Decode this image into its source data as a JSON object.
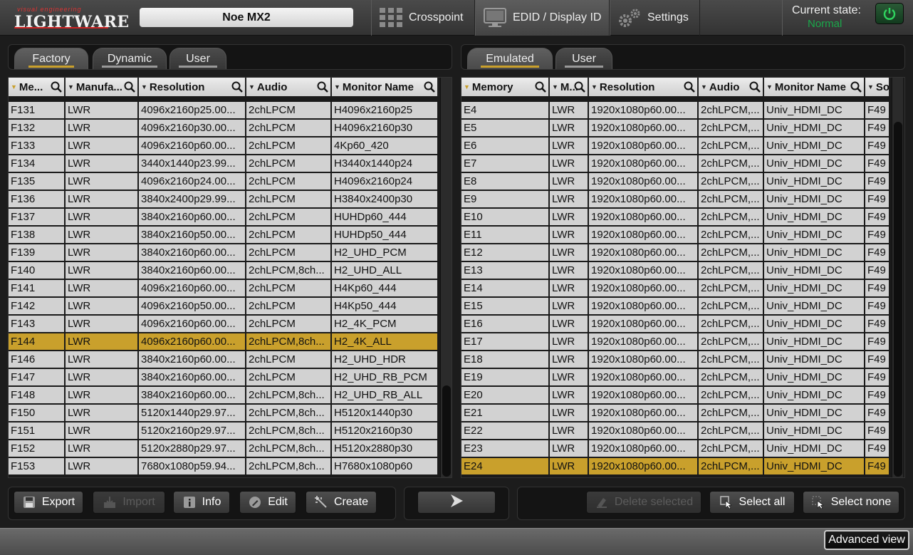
{
  "header": {
    "logo_tag": "visual engineering",
    "logo_brand": "LIGHTWARE",
    "device_name": "Noe MX2",
    "nav": [
      {
        "label": "Crosspoint",
        "icon": "crosspoint-grid-icon"
      },
      {
        "label": "EDID / Display ID",
        "icon": "monitor-icon"
      },
      {
        "label": "Settings",
        "icon": "gears-icon"
      }
    ],
    "active_nav": "EDID / Display ID",
    "state_label": "Current state:",
    "state_value": "Normal",
    "state_color": "#1aa84a"
  },
  "left_panel": {
    "tabs": [
      {
        "label": "Factory"
      },
      {
        "label": "Dynamic"
      },
      {
        "label": "User"
      }
    ],
    "active_tab": "Factory",
    "columns": [
      "Me...",
      "Manufa...",
      "Resolution",
      "Audio",
      "Monitor Name"
    ],
    "rows": [
      [
        "F131",
        "LWR",
        "4096x2160p25.00...",
        "2chLPCM",
        "H4096x2160p25"
      ],
      [
        "F132",
        "LWR",
        "4096x2160p30.00...",
        "2chLPCM",
        "H4096x2160p30"
      ],
      [
        "F133",
        "LWR",
        "4096x2160p60.00...",
        "2chLPCM",
        "4Kp60_420"
      ],
      [
        "F134",
        "LWR",
        "3440x1440p23.99...",
        "2chLPCM",
        "H3440x1440p24"
      ],
      [
        "F135",
        "LWR",
        "4096x2160p24.00...",
        "2chLPCM",
        "H4096x2160p24"
      ],
      [
        "F136",
        "LWR",
        "3840x2400p29.99...",
        "2chLPCM",
        "H3840x2400p30"
      ],
      [
        "F137",
        "LWR",
        "3840x2160p60.00...",
        "2chLPCM",
        "HUHDp60_444"
      ],
      [
        "F138",
        "LWR",
        "3840x2160p50.00...",
        "2chLPCM",
        "HUHDp50_444"
      ],
      [
        "F139",
        "LWR",
        "3840x2160p60.00...",
        "2chLPCM",
        "H2_UHD_PCM"
      ],
      [
        "F140",
        "LWR",
        "3840x2160p60.00...",
        "2chLPCM,8ch...",
        "H2_UHD_ALL"
      ],
      [
        "F141",
        "LWR",
        "4096x2160p60.00...",
        "2chLPCM",
        "H4Kp60_444"
      ],
      [
        "F142",
        "LWR",
        "4096x2160p50.00...",
        "2chLPCM",
        "H4Kp50_444"
      ],
      [
        "F143",
        "LWR",
        "4096x2160p60.00...",
        "2chLPCM",
        "H2_4K_PCM"
      ],
      [
        "F144",
        "LWR",
        "4096x2160p60.00...",
        "2chLPCM,8ch...",
        "H2_4K_ALL"
      ],
      [
        "F146",
        "LWR",
        "3840x2160p60.00...",
        "2chLPCM",
        "H2_UHD_HDR"
      ],
      [
        "F147",
        "LWR",
        "3840x2160p60.00...",
        "2chLPCM",
        "H2_UHD_RB_PCM"
      ],
      [
        "F148",
        "LWR",
        "3840x2160p60.00...",
        "2chLPCM,8ch...",
        "H2_UHD_RB_ALL"
      ],
      [
        "F150",
        "LWR",
        "5120x1440p29.97...",
        "2chLPCM,8ch...",
        "H5120x1440p30"
      ],
      [
        "F151",
        "LWR",
        "5120x2160p29.97...",
        "2chLPCM,8ch...",
        "H5120x2160p30"
      ],
      [
        "F152",
        "LWR",
        "5120x2880p29.97...",
        "2chLPCM,8ch...",
        "H5120x2880p30"
      ],
      [
        "F153",
        "LWR",
        "7680x1080p59.94...",
        "2chLPCM,8ch...",
        "H7680x1080p60"
      ]
    ],
    "selected_row": "F144"
  },
  "right_panel": {
    "tabs": [
      {
        "label": "Emulated"
      },
      {
        "label": "User"
      }
    ],
    "active_tab": "Emulated",
    "columns": [
      "Memory",
      "M...",
      "Resolution",
      "Audio",
      "Monitor Name",
      "So..."
    ],
    "rows": [
      [
        "E4",
        "LWR",
        "1920x1080p60.00...",
        "2chLPCM,...",
        "Univ_HDMI_DC",
        "F49"
      ],
      [
        "E5",
        "LWR",
        "1920x1080p60.00...",
        "2chLPCM,...",
        "Univ_HDMI_DC",
        "F49"
      ],
      [
        "E6",
        "LWR",
        "1920x1080p60.00...",
        "2chLPCM,...",
        "Univ_HDMI_DC",
        "F49"
      ],
      [
        "E7",
        "LWR",
        "1920x1080p60.00...",
        "2chLPCM,...",
        "Univ_HDMI_DC",
        "F49"
      ],
      [
        "E8",
        "LWR",
        "1920x1080p60.00...",
        "2chLPCM,...",
        "Univ_HDMI_DC",
        "F49"
      ],
      [
        "E9",
        "LWR",
        "1920x1080p60.00...",
        "2chLPCM,...",
        "Univ_HDMI_DC",
        "F49"
      ],
      [
        "E10",
        "LWR",
        "1920x1080p60.00...",
        "2chLPCM,...",
        "Univ_HDMI_DC",
        "F49"
      ],
      [
        "E11",
        "LWR",
        "1920x1080p60.00...",
        "2chLPCM,...",
        "Univ_HDMI_DC",
        "F49"
      ],
      [
        "E12",
        "LWR",
        "1920x1080p60.00...",
        "2chLPCM,...",
        "Univ_HDMI_DC",
        "F49"
      ],
      [
        "E13",
        "LWR",
        "1920x1080p60.00...",
        "2chLPCM,...",
        "Univ_HDMI_DC",
        "F49"
      ],
      [
        "E14",
        "LWR",
        "1920x1080p60.00...",
        "2chLPCM,...",
        "Univ_HDMI_DC",
        "F49"
      ],
      [
        "E15",
        "LWR",
        "1920x1080p60.00...",
        "2chLPCM,...",
        "Univ_HDMI_DC",
        "F49"
      ],
      [
        "E16",
        "LWR",
        "1920x1080p60.00...",
        "2chLPCM,...",
        "Univ_HDMI_DC",
        "F49"
      ],
      [
        "E17",
        "LWR",
        "1920x1080p60.00...",
        "2chLPCM,...",
        "Univ_HDMI_DC",
        "F49"
      ],
      [
        "E18",
        "LWR",
        "1920x1080p60.00...",
        "2chLPCM,...",
        "Univ_HDMI_DC",
        "F49"
      ],
      [
        "E19",
        "LWR",
        "1920x1080p60.00...",
        "2chLPCM,...",
        "Univ_HDMI_DC",
        "F49"
      ],
      [
        "E20",
        "LWR",
        "1920x1080p60.00...",
        "2chLPCM,...",
        "Univ_HDMI_DC",
        "F49"
      ],
      [
        "E21",
        "LWR",
        "1920x1080p60.00...",
        "2chLPCM,...",
        "Univ_HDMI_DC",
        "F49"
      ],
      [
        "E22",
        "LWR",
        "1920x1080p60.00...",
        "2chLPCM,...",
        "Univ_HDMI_DC",
        "F49"
      ],
      [
        "E23",
        "LWR",
        "1920x1080p60.00...",
        "2chLPCM,...",
        "Univ_HDMI_DC",
        "F49"
      ],
      [
        "E24",
        "LWR",
        "1920x1080p60.00...",
        "2chLPCM,...",
        "Univ_HDMI_DC",
        "F49"
      ]
    ],
    "selected_row": "E24"
  },
  "left_toolbar": {
    "export": "Export",
    "import": "Import",
    "info": "Info",
    "edit": "Edit",
    "create": "Create"
  },
  "transfer_button": {
    "icon": "arrow-right-icon"
  },
  "right_toolbar": {
    "delete_selected": "Delete selected",
    "select_all": "Select all",
    "select_none": "Select none"
  },
  "footer": {
    "advanced_view": "Advanced view"
  },
  "colors": {
    "accent": "#c9a02c",
    "selected_row": "#c9a02c",
    "cell_bg": "#d2d2d2"
  }
}
